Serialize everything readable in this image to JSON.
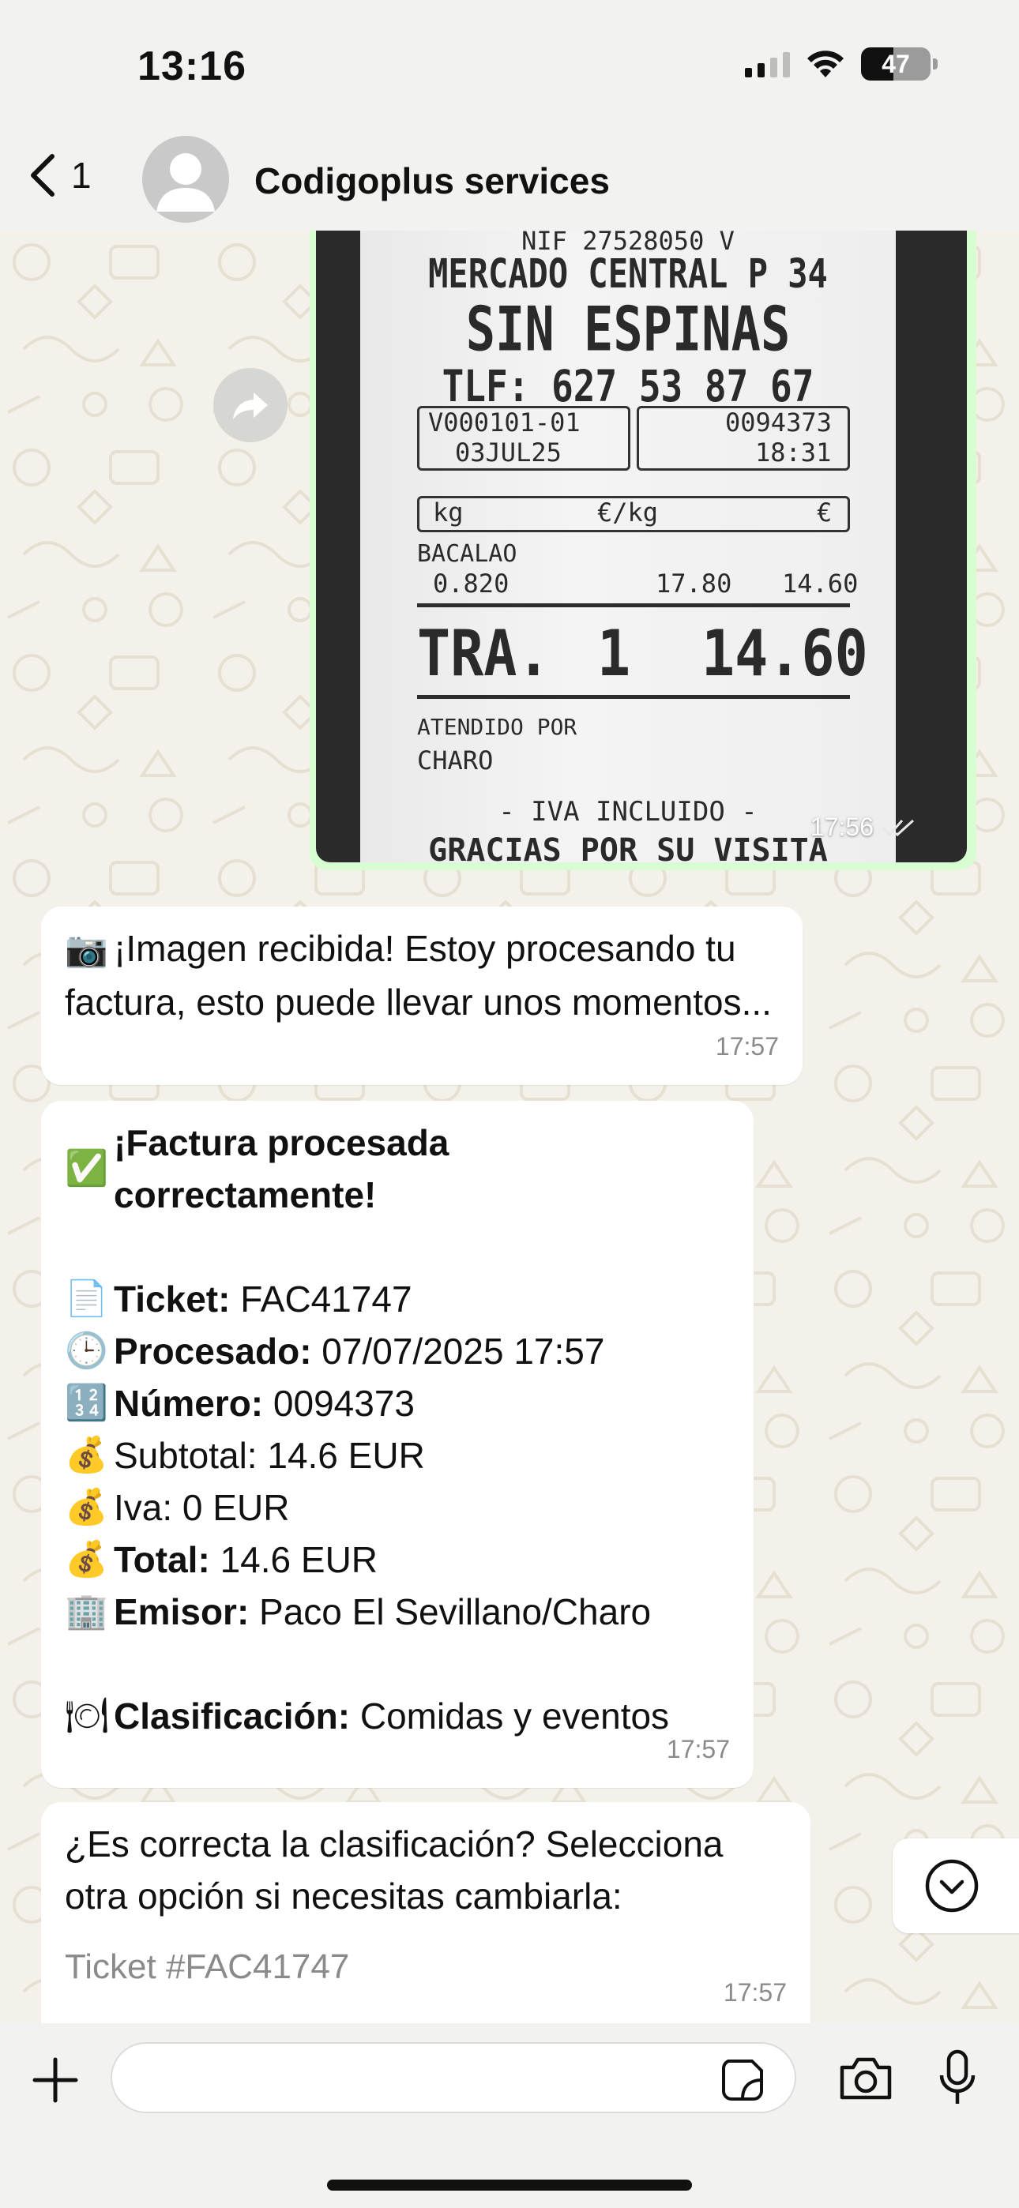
{
  "status_bar": {
    "time": "13:16",
    "battery": "47"
  },
  "header": {
    "back_count": "1",
    "contact_name": "Codigoplus services"
  },
  "image_message": {
    "time": "17:56",
    "receipt": {
      "nif": "NIF 27528050 V",
      "market": "MERCADO CENTRAL P 34",
      "shop": "SIN ESPINAS",
      "phone": "TLF: 627 53 87 67",
      "box_left_1": "V000101-01",
      "box_left_2": "03JUL25",
      "box_right_1": "0094373",
      "box_right_2": "18:31",
      "col_kg": "kg",
      "col_eur_kg": "€/kg",
      "col_eur": "€",
      "item_name": "BACALAO",
      "item_kg": "0.820",
      "item_price": "17.80",
      "item_total": "14.60",
      "tra_label": "TRA.",
      "tra_count": "1",
      "tra_total": "14.60",
      "attended_label": "ATENDIDO POR",
      "attended_name": "CHARO",
      "iva_text": "- IVA INCLUIDO -",
      "thanks": "GRACIAS POR SU VISITA"
    }
  },
  "messages": [
    {
      "emoji": "📷",
      "text": "¡Imagen recibida! Estoy procesando tu factura, esto puede llevar unos momentos...",
      "time": "17:57"
    },
    {
      "title_emoji": "✅",
      "title": "¡Factura procesada correctamente!",
      "lines": [
        {
          "emoji": "📄",
          "label": "Ticket:",
          "value": " FAC41747",
          "bold": true
        },
        {
          "emoji": "🕒",
          "label": "Procesado:",
          "value": " 07/07/2025 17:57",
          "bold": true
        },
        {
          "emoji": "🔢",
          "label": "Número:",
          "value": " 0094373",
          "bold": true
        },
        {
          "emoji": "💰",
          "label": "Subtotal:",
          "value": " 14.6 EUR",
          "bold": false
        },
        {
          "emoji": "💰",
          "label": "Iva:",
          "value": " 0 EUR",
          "bold": false
        },
        {
          "emoji": "💰",
          "label": "Total:",
          "value": " 14.6 EUR",
          "bold": true
        },
        {
          "emoji": "🏢",
          "label": "Emisor:",
          "value": " Paco El Sevillano/Charo",
          "bold": true
        }
      ],
      "classification_emoji": "🍽",
      "classification_label": "Clasificación:",
      "classification_value": " Comidas y eventos",
      "time": "17:57"
    },
    {
      "text_1": "¿Es correcta la clasificación? Selecciona",
      "text_2": "otra opción si necesitas cambiarla:",
      "footer": "Ticket #FAC41747",
      "time": "17:57"
    }
  ],
  "input": {
    "placeholder": ""
  },
  "colors": {
    "outgoing_bubble": "#d9fdd3",
    "incoming_bubble": "#ffffff",
    "chat_background": "#f4f1ea"
  }
}
